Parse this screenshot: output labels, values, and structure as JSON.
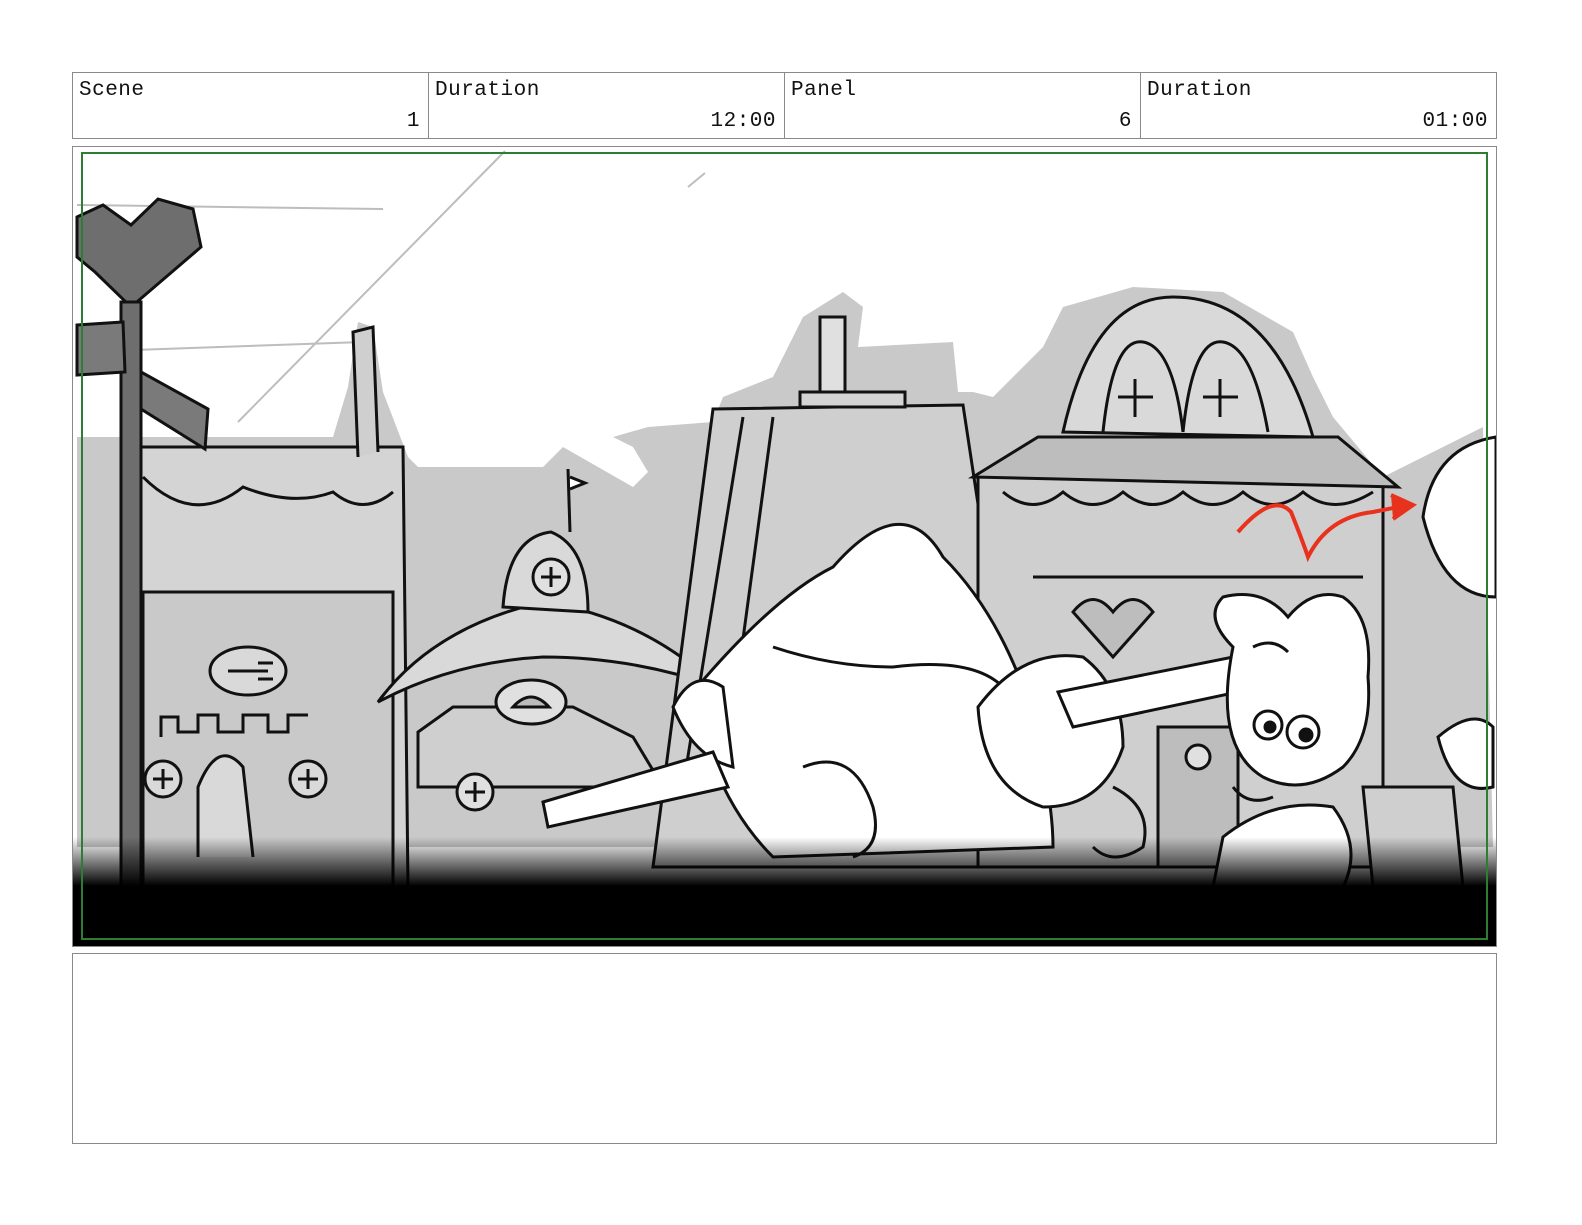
{
  "header": {
    "scene": {
      "label": "Scene",
      "value": "1"
    },
    "scene_duration": {
      "label": "Duration",
      "value": "12:00"
    },
    "panel": {
      "label": "Panel",
      "value": "6"
    },
    "panel_duration": {
      "label": "Duration",
      "value": "01:00"
    }
  },
  "panel_image": {
    "subject": "storyboard-sketch-town-street",
    "colors": {
      "sketch_line": "#111111",
      "fill_gray": "#c9c9c9",
      "dark_gray": "#6e6e6e",
      "frame_green": "#2e7d32",
      "motion_red": "#e8321e"
    }
  },
  "notes": {
    "text": ""
  }
}
